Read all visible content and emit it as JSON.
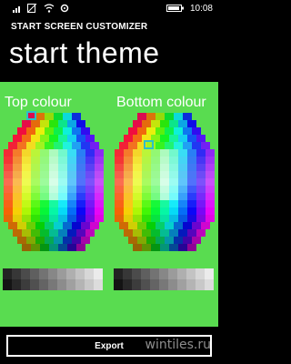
{
  "status_bar": {
    "time": "10:08",
    "icons": [
      "signal-icon",
      "no-sim-icon",
      "wifi-icon",
      "settings-icon",
      "battery-icon"
    ]
  },
  "header": {
    "app_title": "START SCREEN CUSTOMIZER",
    "page_title": "start theme"
  },
  "pickers": {
    "top_label": "Top colour",
    "bottom_label": "Bottom colour",
    "background_color": "#59dc50",
    "selection_color": "#2bc0c8"
  },
  "app_bar": {
    "export_label": "Export"
  },
  "watermark": {
    "text": "wintiles.ru"
  }
}
